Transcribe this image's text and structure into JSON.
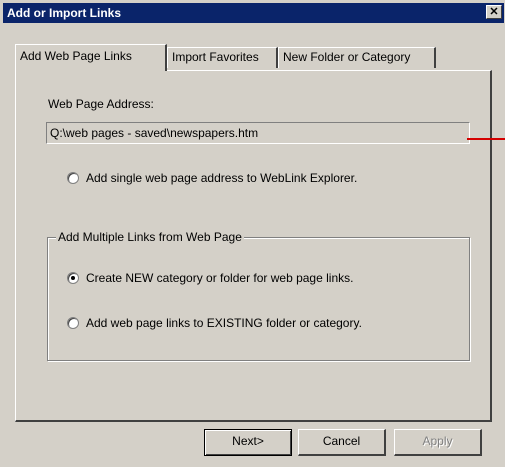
{
  "window": {
    "title": "Add or Import Links",
    "close_glyph": "✕"
  },
  "tabs": [
    {
      "label": "Add Web Page Links",
      "active": true
    },
    {
      "label": "Import Favorites",
      "active": false
    },
    {
      "label": "New Folder or Category",
      "active": false
    }
  ],
  "form": {
    "address_label": "Web Page Address:",
    "address_value": "Q:\\web pages - saved\\newspapers.htm",
    "single_option": "Add single web page address to WebLink Explorer.",
    "group_title": "Add Multiple Links from Web Page",
    "new_category_option": "Create NEW category or folder for web page links.",
    "existing_option": "Add web page links to EXISTING folder or category.",
    "selected_option": "new_category"
  },
  "buttons": {
    "next": "Next>",
    "cancel": "Cancel",
    "apply": "Apply"
  },
  "annotation": {
    "color": "#d40000"
  }
}
